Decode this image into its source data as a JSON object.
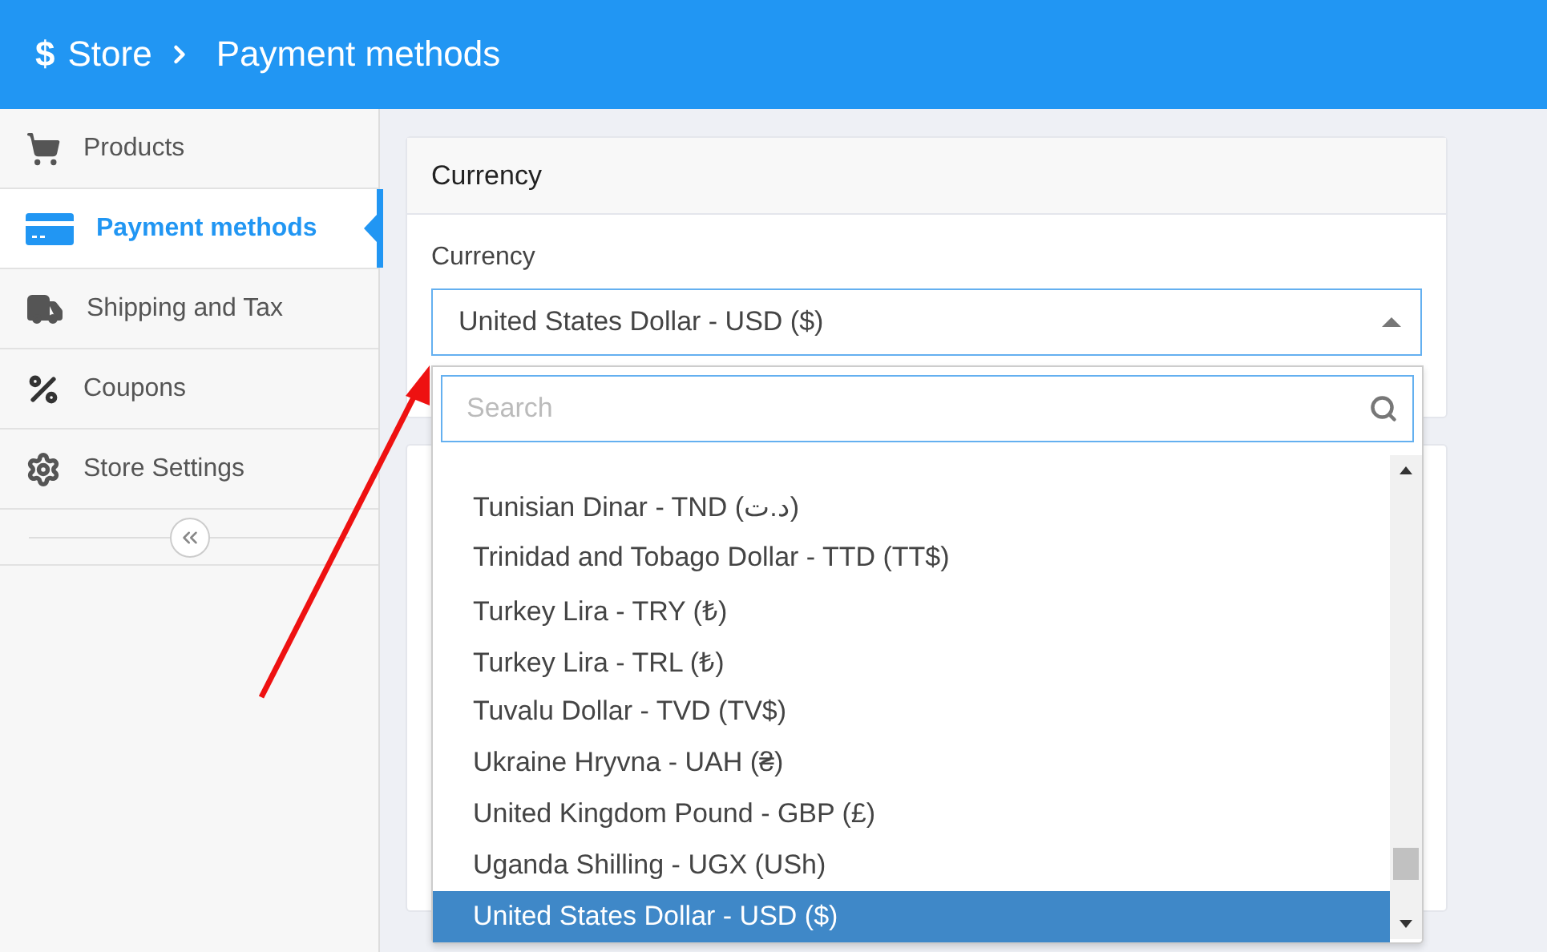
{
  "header": {
    "logo_symbol": "$",
    "breadcrumb": [
      {
        "label": "Store"
      },
      {
        "label": "Payment methods"
      }
    ]
  },
  "sidebar": {
    "items": [
      {
        "label": "Products",
        "kind": "cart",
        "selected": false
      },
      {
        "label": "Payment methods",
        "kind": "card",
        "selected": true
      },
      {
        "label": "Shipping and Tax",
        "kind": "truck",
        "selected": false
      },
      {
        "label": "Coupons",
        "kind": "percent",
        "selected": false
      },
      {
        "label": "Store Settings",
        "kind": "gear",
        "selected": false
      }
    ]
  },
  "card": {
    "title": "Currency",
    "field_label": "Currency",
    "value": "United States Dollar - USD ($)",
    "expanded": true
  },
  "dropdown": {
    "search": {
      "placeholder": "Search"
    },
    "options": [
      {
        "label": "Tunisian Dinar - TND (د.ت)",
        "selected": false
      },
      {
        "label": "Trinidad and Tobago Dollar - TTD (TT$)",
        "selected": false
      },
      {
        "label": "Turkey Lira - TRY (₺)",
        "selected": false
      },
      {
        "label": "Turkey Lira - TRL (₺)",
        "selected": false
      },
      {
        "label": "Tuvalu Dollar - TVD (TV$)",
        "selected": false
      },
      {
        "label": "Ukraine Hryvna - UAH (₴)",
        "selected": false
      },
      {
        "label": "United Kingdom Pound - GBP (£)",
        "selected": false
      },
      {
        "label": "Uganda Shilling - UGX (USh)",
        "selected": false
      },
      {
        "label": "United States Dollar - USD ($)",
        "selected": true
      }
    ]
  }
}
